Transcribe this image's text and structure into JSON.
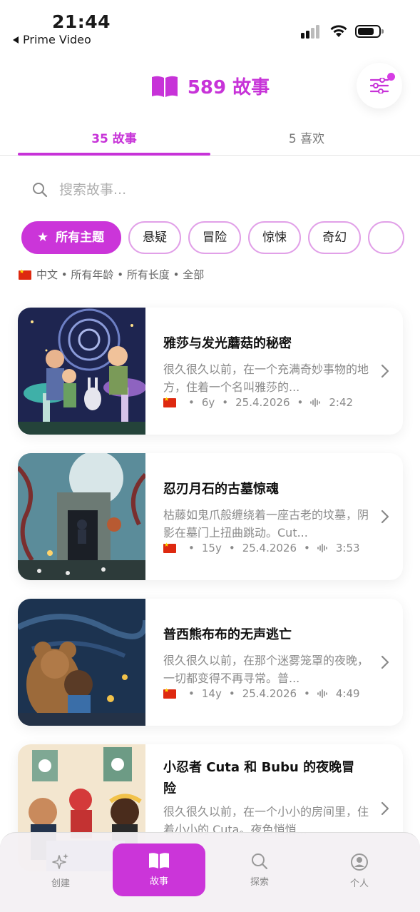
{
  "status_bar": {
    "time": "21:44",
    "back_app": "Prime Video"
  },
  "header": {
    "title": "589 故事",
    "accent_color": "#c733d8"
  },
  "tabs": [
    {
      "label": "35 故事",
      "active": true
    },
    {
      "label": "5 喜欢",
      "active": false
    }
  ],
  "search": {
    "placeholder": "搜索故事..."
  },
  "chips": [
    {
      "label": "所有主题",
      "active": true,
      "icon": "star-icon"
    },
    {
      "label": "悬疑",
      "active": false
    },
    {
      "label": "冒险",
      "active": false
    },
    {
      "label": "惊悚",
      "active": false
    },
    {
      "label": "奇幻",
      "active": false
    }
  ],
  "filter_summary": {
    "language": "中文",
    "age": "所有年龄",
    "length": "所有长度",
    "scope": "全部"
  },
  "stories": [
    {
      "title": "雅莎与发光蘑菇的秘密",
      "excerpt": "很久很久以前，在一个充满奇妙事物的地方，住着一个名叫雅莎的...",
      "age": "6y",
      "date": "25.4.2026",
      "duration": "2:42"
    },
    {
      "title": "忍刃月石的古墓惊魂",
      "excerpt": "枯藤如鬼爪般缠绕着一座古老的坟墓，阴影在墓门上扭曲跳动。Cut...",
      "age": "15y",
      "date": "25.4.2026",
      "duration": "3:53"
    },
    {
      "title": "普西熊布布的无声逃亡",
      "excerpt": "很久很久以前，在那个迷雾笼罩的夜晚，一切都变得不再寻常。普...",
      "age": "14y",
      "date": "25.4.2026",
      "duration": "4:49"
    },
    {
      "title": "小忍者 Cuta 和 Bubu 的夜晚冒险",
      "excerpt": "很久很久以前，在一个小小的房间里，住着小小的 Cuta。夜色悄悄...",
      "age": "",
      "date": "",
      "duration": ""
    }
  ],
  "bottom_nav": [
    {
      "label": "创建",
      "icon": "sparkle-icon",
      "active": false
    },
    {
      "label": "故事",
      "icon": "book-icon",
      "active": true
    },
    {
      "label": "探索",
      "icon": "search-icon",
      "active": false
    },
    {
      "label": "个人",
      "icon": "person-icon",
      "active": false
    }
  ]
}
